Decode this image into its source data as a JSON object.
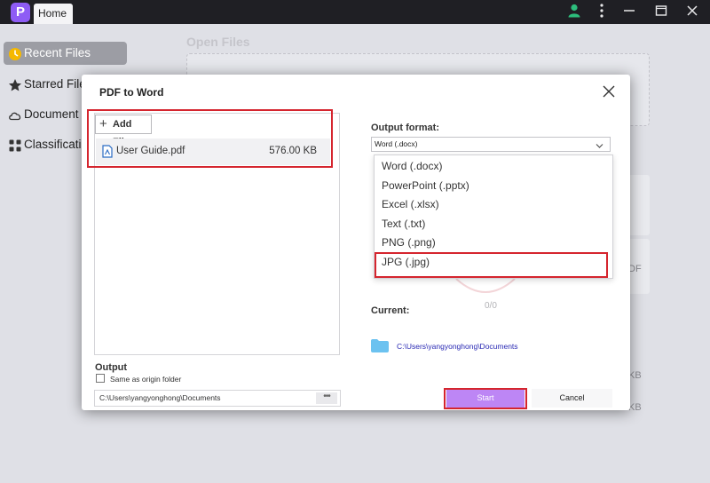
{
  "titlebar": {
    "app_logo": "P",
    "home_tab": "Home"
  },
  "sidebar": {
    "items": [
      {
        "label": "Recent Files",
        "icon": "clock-icon"
      },
      {
        "label": "Starred Files",
        "icon": "star-icon"
      },
      {
        "label": "Document",
        "icon": "cloud-icon"
      },
      {
        "label": "Classification",
        "icon": "grid-icon"
      }
    ]
  },
  "content": {
    "open_files_title": "Open Files",
    "bg_size_1": "KB",
    "bg_size_2": "KB",
    "bg_pdf": "DF"
  },
  "dialog": {
    "title": "PDF to Word",
    "add_files_label": "Add Files",
    "files": [
      {
        "name": "User Guide.pdf",
        "size": "576.00 KB"
      }
    ],
    "output_label": "Output",
    "same_as_origin_label": "Same as origin folder",
    "output_path": "C:\\Users\\yangyonghong\\Documents",
    "output_dots": "•••",
    "output_format_label": "Output format:",
    "selected_format": "Word (.docx)",
    "format_options": [
      "Word (.docx)",
      "PowerPoint (.pptx)",
      "Excel (.xlsx)",
      "Text (.txt)",
      "PNG (.png)",
      "JPG (.jpg)"
    ],
    "current_label": "Current:",
    "progress_count": "0/0",
    "current_path": "C:\\Users\\yangyonghong\\Documents",
    "start_label": "Start",
    "cancel_label": "Cancel"
  },
  "colors": {
    "accent": "#8e5cf5",
    "start_button": "#bd86f5",
    "highlight_box": "#d5252e",
    "path_link": "#2a2ab4"
  }
}
